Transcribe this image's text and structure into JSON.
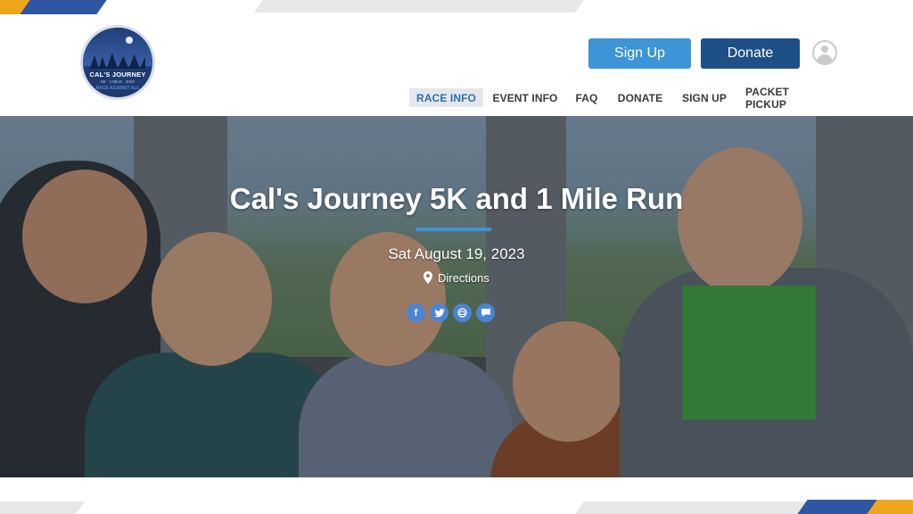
{
  "colors": {
    "brand_blue": "#3d94d6",
    "brand_navy": "#1f4f87",
    "accent_orange": "#f0a61b",
    "social_blue": "#4c84d4"
  },
  "logo": {
    "title": "CAL'S JOURNEY",
    "subtitle": "5K · 1 MILE · 2023",
    "tagline": "RACE AGAINST ALL"
  },
  "header": {
    "signup_label": "Sign Up",
    "donate_label": "Donate",
    "user_icon": "user-avatar-icon"
  },
  "nav": {
    "items": [
      {
        "label": "RACE INFO",
        "active": true
      },
      {
        "label": "EVENT INFO",
        "active": false
      },
      {
        "label": "FAQ",
        "active": false
      },
      {
        "label": "DONATE",
        "active": false
      },
      {
        "label": "SIGN UP",
        "active": false
      },
      {
        "label": "PACKET PICKUP",
        "active": false
      }
    ]
  },
  "hero": {
    "title": "Cal's Journey 5K and 1 Mile Run",
    "date": "Sat August 19, 2023",
    "directions_label": "Directions",
    "social": [
      {
        "icon": "facebook-icon",
        "glyph": "f"
      },
      {
        "icon": "twitter-icon",
        "glyph": "t"
      },
      {
        "icon": "email-icon",
        "glyph": "@"
      },
      {
        "icon": "message-icon",
        "glyph": "…"
      }
    ]
  }
}
